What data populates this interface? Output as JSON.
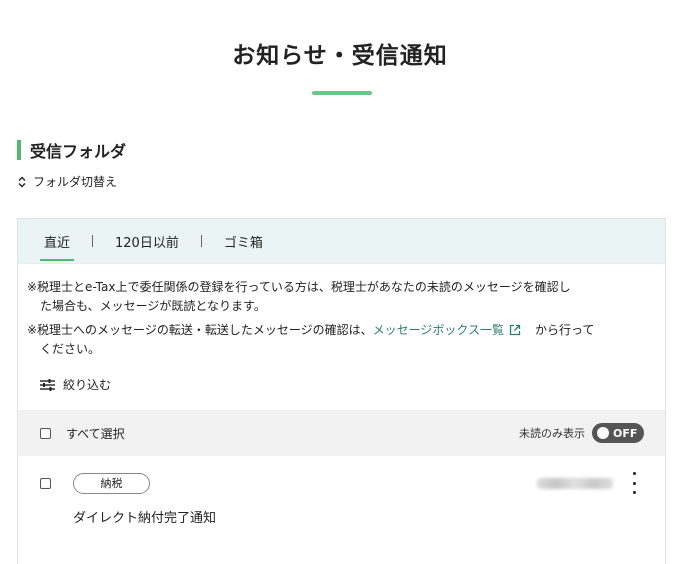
{
  "page": {
    "title": "お知らせ・受信通知"
  },
  "section": {
    "title": "受信フォルダ"
  },
  "folder_switch": {
    "label": "フォルダ切替え"
  },
  "tabs": [
    {
      "label": "直近",
      "active": true
    },
    {
      "label": "120日以前",
      "active": false
    },
    {
      "label": "ゴミ箱",
      "active": false
    }
  ],
  "notes": {
    "note1_line1": "※税理士とe-Tax上で委任関係の登録を行っている方は、税理士があなたの未読のメッセージを確認し",
    "note1_line2": "た場合も、メッセージが既読となります。",
    "note2_prefix": "※税理士へのメッセージの転送・転送したメッセージの確認は、",
    "note2_link": "メッセージボックス一覧",
    "note2_suffix": "から行って",
    "note2_line2": "ください。"
  },
  "filter": {
    "label": "絞り込む"
  },
  "select_bar": {
    "select_all_label": "すべて選択",
    "unread_only_label": "未読のみ表示",
    "toggle_state": "OFF"
  },
  "messages": [
    {
      "tag": "納税",
      "subject": "ダイレクト納付完了通知"
    }
  ],
  "colors": {
    "accent": "#4fb873",
    "link": "#2a7f6f",
    "tab_bar": "#eaf4f5",
    "toggle_bg": "#555555"
  }
}
